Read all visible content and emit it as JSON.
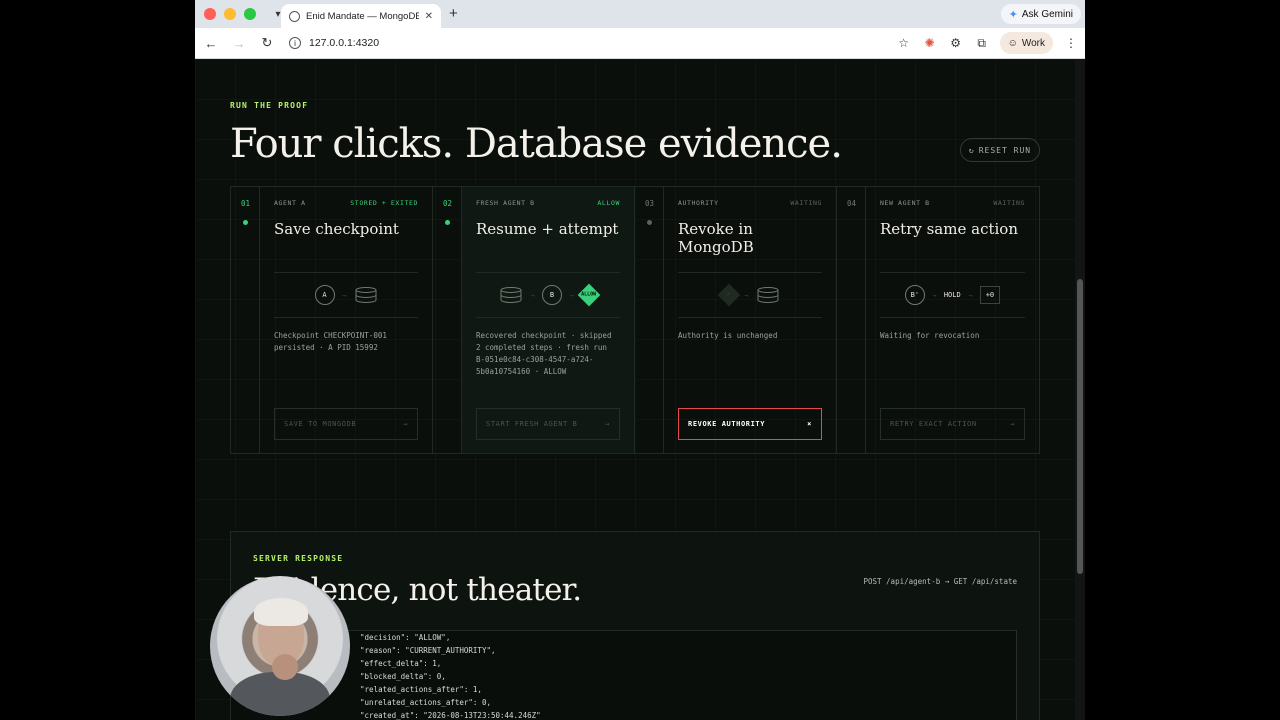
{
  "browser": {
    "tab_title": "Enid Mandate — MongoDB a…",
    "url": "127.0.0.1:4320",
    "ask_gemini": "Ask Gemini",
    "profile": "Work"
  },
  "proof": {
    "eyebrow": "RUN THE PROOF",
    "title": "Four clicks. Database evidence.",
    "reset_label": "RESET RUN",
    "steps": [
      {
        "num": "01",
        "label": "AGENT A",
        "status": "STORED + EXITED",
        "title": "Save checkpoint",
        "node_a": "A",
        "desc": "Checkpoint CHECKPOINT-001 persisted · A PID 15992",
        "action": "SAVE TO MONGODB"
      },
      {
        "num": "02",
        "label": "FRESH AGENT B",
        "status": "ALLOW",
        "title": "Resume + attempt",
        "node_b": "B",
        "diamond": "ALLOW",
        "desc": "Recovered checkpoint · skipped 2 completed steps · fresh run B-051e0c84-c308-4547-a724-5b0a10754160 · ALLOW",
        "action": "START FRESH AGENT B"
      },
      {
        "num": "03",
        "label": "AUTHORITY",
        "status": "WAITING",
        "title": "Revoke in MongoDB",
        "diamond": "✓",
        "desc": "Authority is unchanged",
        "action": "REVOKE AUTHORITY"
      },
      {
        "num": "04",
        "label": "NEW AGENT B",
        "status": "WAITING",
        "title": "Retry same action",
        "node_b": "B'",
        "hold": "HOLD",
        "box": "+0",
        "desc": "Waiting for revocation",
        "action": "RETRY EXACT ACTION"
      }
    ]
  },
  "response": {
    "eyebrow": "SERVER RESPONSE",
    "title": "Evidence, not theater.",
    "endpoint": "POST /api/agent-b → GET /api/state",
    "code_lines": [
      "  \"decision\": \"ALLOW\",",
      "  \"reason\": \"CURRENT_AUTHORITY\",",
      "  \"effect_delta\": 1,",
      "  \"blocked_delta\": 0,",
      "  \"related_actions_after\": 1,",
      "  \"unrelated_actions_after\": 0,",
      "  \"created_at\": \"2026-08-13T23:50:44.246Z\""
    ]
  },
  "colors": {
    "accent_green": "#38d27a",
    "eyebrow_lime": "#b6f36b",
    "danger_red": "#e5484d"
  }
}
